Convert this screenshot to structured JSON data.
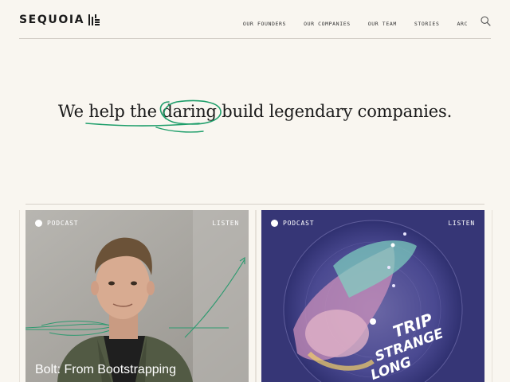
{
  "header": {
    "logo_text": "SEQUOIA",
    "nav": [
      {
        "label": "OUR FOUNDERS"
      },
      {
        "label": "OUR COMPANIES"
      },
      {
        "label": "OUR TEAM"
      },
      {
        "label": "STORIES"
      },
      {
        "label": "ARC"
      }
    ],
    "search_icon": "search-icon"
  },
  "hero": {
    "headline": "We help the daring build legendary companies.",
    "accent_color": "#1e9e6a"
  },
  "cards": [
    {
      "tag": "PODCAST",
      "action": "LISTEN",
      "title": "Bolt: From Bootstrapping"
    },
    {
      "tag": "PODCAST",
      "action": "LISTEN",
      "title": "",
      "art_text": [
        "LONG",
        "STRANGE",
        "TRIP"
      ]
    }
  ],
  "colors": {
    "background": "#f9f6f0",
    "text": "#1a1a1a",
    "card2_background": "#3a3a7c"
  }
}
